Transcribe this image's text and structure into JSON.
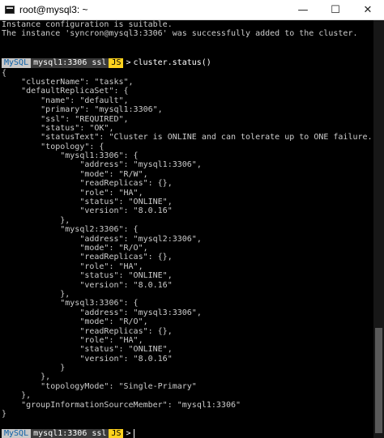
{
  "window": {
    "title": "root@mysql3: ~",
    "icon": "terminal-icon",
    "controls": {
      "minimize": "—",
      "maximize": "☐",
      "close": "✕"
    }
  },
  "terminal": {
    "output_top": [
      "Instance configuration is suitable.",
      "The instance 'syncron@mysql3:3306' was successfully added to the cluster."
    ],
    "prompt": {
      "mysql_label": "MySQL",
      "host_label": "mysql1:3306 ssl",
      "mode_label": "JS",
      "arrow": ">"
    },
    "command": "cluster.status()",
    "result_lines": [
      "{",
      "    \"clusterName\": \"tasks\",",
      "    \"defaultReplicaSet\": {",
      "        \"name\": \"default\",",
      "        \"primary\": \"mysql1:3306\",",
      "        \"ssl\": \"REQUIRED\",",
      "        \"status\": \"OK\",",
      "        \"statusText\": \"Cluster is ONLINE and can tolerate up to ONE failure.\",",
      "        \"topology\": {",
      "            \"mysql1:3306\": {",
      "                \"address\": \"mysql1:3306\",",
      "                \"mode\": \"R/W\",",
      "                \"readReplicas\": {},",
      "                \"role\": \"HA\",",
      "                \"status\": \"ONLINE\",",
      "                \"version\": \"8.0.16\"",
      "            },",
      "            \"mysql2:3306\": {",
      "                \"address\": \"mysql2:3306\",",
      "                \"mode\": \"R/O\",",
      "                \"readReplicas\": {},",
      "                \"role\": \"HA\",",
      "                \"status\": \"ONLINE\",",
      "                \"version\": \"8.0.16\"",
      "            },",
      "            \"mysql3:3306\": {",
      "                \"address\": \"mysql3:3306\",",
      "                \"mode\": \"R/O\",",
      "                \"readReplicas\": {},",
      "                \"role\": \"HA\",",
      "                \"status\": \"ONLINE\",",
      "                \"version\": \"8.0.16\"",
      "            }",
      "        },",
      "        \"topologyMode\": \"Single-Primary\"",
      "    },",
      "    \"groupInformationSourceMember\": \"mysql1:3306\"",
      "}"
    ]
  }
}
